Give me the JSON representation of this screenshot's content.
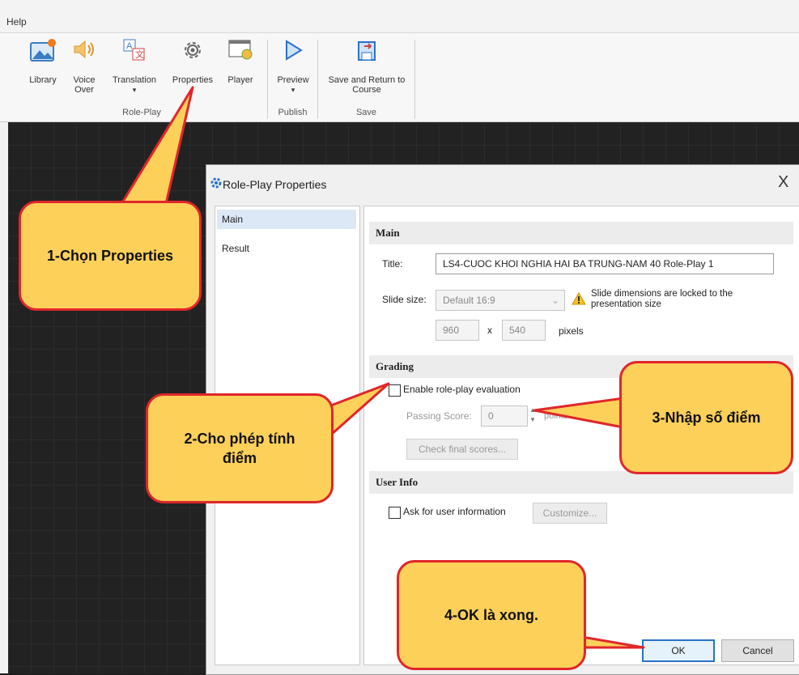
{
  "menu": {
    "help": "Help"
  },
  "ribbon": {
    "buttons": [
      {
        "label": "Library",
        "icon": "library-icon"
      },
      {
        "label": "Voice Over",
        "icon": "speaker-icon"
      },
      {
        "label": "Translation",
        "icon": "translation-icon"
      },
      {
        "label": "Properties",
        "icon": "gear-icon"
      },
      {
        "label": "Player",
        "icon": "player-icon"
      },
      {
        "label": "Preview",
        "icon": "play-icon"
      },
      {
        "label": "Save and Return to Course",
        "icon": "save-return-icon"
      }
    ],
    "groups": {
      "roleplay": "Role-Play",
      "publish": "Publish",
      "save": "Save"
    }
  },
  "dialog": {
    "title": "Role-Play Properties",
    "close": "X",
    "nav": [
      "Main",
      "Result"
    ],
    "main": {
      "header": "Main",
      "title_label": "Title:",
      "title_value": "LS4-CUOC KHOI NGHIA HAI BA TRUNG-NAM 40 Role-Play 1",
      "slide_size_label": "Slide size:",
      "slide_size_value": "Default 16:9",
      "slide_note": "Slide dimensions are locked to the presentation size",
      "width": "960",
      "x": "x",
      "height": "540",
      "pixels": "pixels"
    },
    "grading": {
      "header": "Grading",
      "enable_label": "Enable role-play evaluation",
      "passing_label": "Passing Score:",
      "passing_value": "0",
      "passing_suffix": "points of 0 (100",
      "check_button": "Check final scores..."
    },
    "userinfo": {
      "header": "User Info",
      "ask_label": "Ask for user information",
      "customize_button": "Customize..."
    },
    "ok": "OK",
    "cancel": "Cancel"
  },
  "callouts": {
    "c1": "1-Chọn Properties",
    "c2": "2-Cho phép tính điểm",
    "c3": "3-Nhập số điểm",
    "c4": "4-OK là xong."
  },
  "colors": {
    "callout_fill": "#fdd05a",
    "callout_border": "#e0262b",
    "accent_blue": "#2a72c8"
  }
}
